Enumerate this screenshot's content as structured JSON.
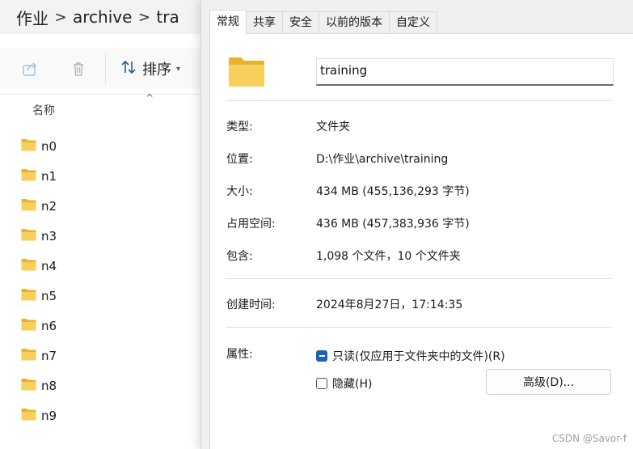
{
  "explorer": {
    "breadcrumb": [
      "作业",
      "archive",
      "tra"
    ],
    "breadcrumb_sep": ">",
    "sort_label": "排序",
    "column_name": "名称",
    "files": [
      "n0",
      "n1",
      "n2",
      "n3",
      "n4",
      "n5",
      "n6",
      "n7",
      "n8",
      "n9"
    ]
  },
  "dialog": {
    "tabs": [
      "常规",
      "共享",
      "安全",
      "以前的版本",
      "自定义"
    ],
    "active_tab": 0,
    "folder_name": "training",
    "props": {
      "type_label": "类型:",
      "type_value": "文件夹",
      "location_label": "位置:",
      "location_value": "D:\\作业\\archive\\training",
      "size_label": "大小:",
      "size_value": "434 MB (455,136,293 字节)",
      "disk_label": "占用空间:",
      "disk_value": "436 MB (457,383,936 字节)",
      "contains_label": "包含:",
      "contains_value": "1,098 个文件，10 个文件夹",
      "created_label": "创建时间:",
      "created_value": "2024年8月27日，17:14:35",
      "attrs_label": "属性:",
      "readonly_label": "只读(仅应用于文件夹中的文件)(R)",
      "hidden_label": "隐藏(H)",
      "advanced_label": "高级(D)..."
    }
  },
  "watermark": "CSDN @Savor-f",
  "colors": {
    "folder": "#f4c430",
    "accent": "#1a63b8"
  }
}
